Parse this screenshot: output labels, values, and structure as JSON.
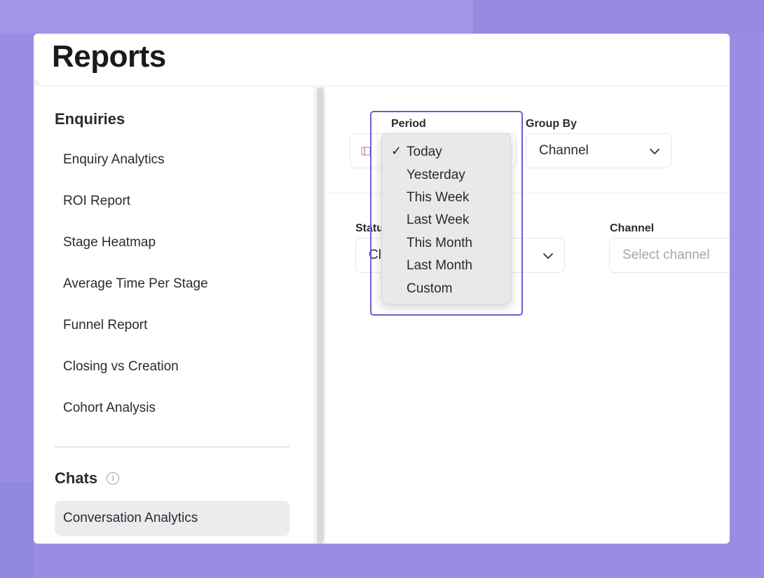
{
  "page": {
    "title": "Reports"
  },
  "sidebar": {
    "sections": [
      {
        "heading": "Enquiries",
        "items": [
          {
            "label": "Enquiry Analytics"
          },
          {
            "label": "ROI Report"
          },
          {
            "label": "Stage Heatmap"
          },
          {
            "label": "Average Time Per Stage"
          },
          {
            "label": "Funnel Report"
          },
          {
            "label": "Closing vs Creation"
          },
          {
            "label": "Cohort Analysis"
          }
        ]
      },
      {
        "heading": "Chats",
        "info_icon": "info-icon",
        "items": [
          {
            "label": "Conversation Analytics",
            "active": true
          }
        ]
      }
    ]
  },
  "filters": {
    "period": {
      "label": "Period",
      "open": true,
      "selected": "Today",
      "options": [
        "Today",
        "Yesterday",
        "This Week",
        "Last Week",
        "This Month",
        "Last Month",
        "Custom"
      ]
    },
    "group_by": {
      "label": "Group By",
      "value": "Channel"
    },
    "status": {
      "label": "Statu",
      "value": "Cl"
    },
    "channel": {
      "label": "Channel",
      "placeholder": "Select channel"
    }
  },
  "colors": {
    "background": "#9a8ce3",
    "focus_ring": "#6d5ed3",
    "active_item": "#ececef"
  }
}
